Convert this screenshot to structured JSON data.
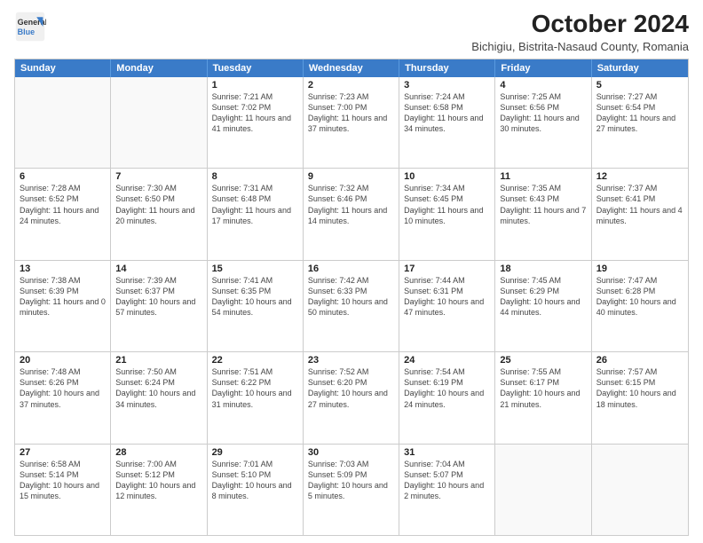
{
  "header": {
    "logo_line1": "General",
    "logo_line2": "Blue",
    "month": "October 2024",
    "location": "Bichigiu, Bistrita-Nasaud County, Romania"
  },
  "days_of_week": [
    "Sunday",
    "Monday",
    "Tuesday",
    "Wednesday",
    "Thursday",
    "Friday",
    "Saturday"
  ],
  "weeks": [
    [
      {
        "day": "",
        "empty": true
      },
      {
        "day": "",
        "empty": true
      },
      {
        "day": "1",
        "sunrise": "Sunrise: 7:21 AM",
        "sunset": "Sunset: 7:02 PM",
        "daylight": "Daylight: 11 hours and 41 minutes."
      },
      {
        "day": "2",
        "sunrise": "Sunrise: 7:23 AM",
        "sunset": "Sunset: 7:00 PM",
        "daylight": "Daylight: 11 hours and 37 minutes."
      },
      {
        "day": "3",
        "sunrise": "Sunrise: 7:24 AM",
        "sunset": "Sunset: 6:58 PM",
        "daylight": "Daylight: 11 hours and 34 minutes."
      },
      {
        "day": "4",
        "sunrise": "Sunrise: 7:25 AM",
        "sunset": "Sunset: 6:56 PM",
        "daylight": "Daylight: 11 hours and 30 minutes."
      },
      {
        "day": "5",
        "sunrise": "Sunrise: 7:27 AM",
        "sunset": "Sunset: 6:54 PM",
        "daylight": "Daylight: 11 hours and 27 minutes."
      }
    ],
    [
      {
        "day": "6",
        "sunrise": "Sunrise: 7:28 AM",
        "sunset": "Sunset: 6:52 PM",
        "daylight": "Daylight: 11 hours and 24 minutes."
      },
      {
        "day": "7",
        "sunrise": "Sunrise: 7:30 AM",
        "sunset": "Sunset: 6:50 PM",
        "daylight": "Daylight: 11 hours and 20 minutes."
      },
      {
        "day": "8",
        "sunrise": "Sunrise: 7:31 AM",
        "sunset": "Sunset: 6:48 PM",
        "daylight": "Daylight: 11 hours and 17 minutes."
      },
      {
        "day": "9",
        "sunrise": "Sunrise: 7:32 AM",
        "sunset": "Sunset: 6:46 PM",
        "daylight": "Daylight: 11 hours and 14 minutes."
      },
      {
        "day": "10",
        "sunrise": "Sunrise: 7:34 AM",
        "sunset": "Sunset: 6:45 PM",
        "daylight": "Daylight: 11 hours and 10 minutes."
      },
      {
        "day": "11",
        "sunrise": "Sunrise: 7:35 AM",
        "sunset": "Sunset: 6:43 PM",
        "daylight": "Daylight: 11 hours and 7 minutes."
      },
      {
        "day": "12",
        "sunrise": "Sunrise: 7:37 AM",
        "sunset": "Sunset: 6:41 PM",
        "daylight": "Daylight: 11 hours and 4 minutes."
      }
    ],
    [
      {
        "day": "13",
        "sunrise": "Sunrise: 7:38 AM",
        "sunset": "Sunset: 6:39 PM",
        "daylight": "Daylight: 11 hours and 0 minutes."
      },
      {
        "day": "14",
        "sunrise": "Sunrise: 7:39 AM",
        "sunset": "Sunset: 6:37 PM",
        "daylight": "Daylight: 10 hours and 57 minutes."
      },
      {
        "day": "15",
        "sunrise": "Sunrise: 7:41 AM",
        "sunset": "Sunset: 6:35 PM",
        "daylight": "Daylight: 10 hours and 54 minutes."
      },
      {
        "day": "16",
        "sunrise": "Sunrise: 7:42 AM",
        "sunset": "Sunset: 6:33 PM",
        "daylight": "Daylight: 10 hours and 50 minutes."
      },
      {
        "day": "17",
        "sunrise": "Sunrise: 7:44 AM",
        "sunset": "Sunset: 6:31 PM",
        "daylight": "Daylight: 10 hours and 47 minutes."
      },
      {
        "day": "18",
        "sunrise": "Sunrise: 7:45 AM",
        "sunset": "Sunset: 6:29 PM",
        "daylight": "Daylight: 10 hours and 44 minutes."
      },
      {
        "day": "19",
        "sunrise": "Sunrise: 7:47 AM",
        "sunset": "Sunset: 6:28 PM",
        "daylight": "Daylight: 10 hours and 40 minutes."
      }
    ],
    [
      {
        "day": "20",
        "sunrise": "Sunrise: 7:48 AM",
        "sunset": "Sunset: 6:26 PM",
        "daylight": "Daylight: 10 hours and 37 minutes."
      },
      {
        "day": "21",
        "sunrise": "Sunrise: 7:50 AM",
        "sunset": "Sunset: 6:24 PM",
        "daylight": "Daylight: 10 hours and 34 minutes."
      },
      {
        "day": "22",
        "sunrise": "Sunrise: 7:51 AM",
        "sunset": "Sunset: 6:22 PM",
        "daylight": "Daylight: 10 hours and 31 minutes."
      },
      {
        "day": "23",
        "sunrise": "Sunrise: 7:52 AM",
        "sunset": "Sunset: 6:20 PM",
        "daylight": "Daylight: 10 hours and 27 minutes."
      },
      {
        "day": "24",
        "sunrise": "Sunrise: 7:54 AM",
        "sunset": "Sunset: 6:19 PM",
        "daylight": "Daylight: 10 hours and 24 minutes."
      },
      {
        "day": "25",
        "sunrise": "Sunrise: 7:55 AM",
        "sunset": "Sunset: 6:17 PM",
        "daylight": "Daylight: 10 hours and 21 minutes."
      },
      {
        "day": "26",
        "sunrise": "Sunrise: 7:57 AM",
        "sunset": "Sunset: 6:15 PM",
        "daylight": "Daylight: 10 hours and 18 minutes."
      }
    ],
    [
      {
        "day": "27",
        "sunrise": "Sunrise: 6:58 AM",
        "sunset": "Sunset: 5:14 PM",
        "daylight": "Daylight: 10 hours and 15 minutes."
      },
      {
        "day": "28",
        "sunrise": "Sunrise: 7:00 AM",
        "sunset": "Sunset: 5:12 PM",
        "daylight": "Daylight: 10 hours and 12 minutes."
      },
      {
        "day": "29",
        "sunrise": "Sunrise: 7:01 AM",
        "sunset": "Sunset: 5:10 PM",
        "daylight": "Daylight: 10 hours and 8 minutes."
      },
      {
        "day": "30",
        "sunrise": "Sunrise: 7:03 AM",
        "sunset": "Sunset: 5:09 PM",
        "daylight": "Daylight: 10 hours and 5 minutes."
      },
      {
        "day": "31",
        "sunrise": "Sunrise: 7:04 AM",
        "sunset": "Sunset: 5:07 PM",
        "daylight": "Daylight: 10 hours and 2 minutes."
      },
      {
        "day": "",
        "empty": true
      },
      {
        "day": "",
        "empty": true
      }
    ]
  ]
}
